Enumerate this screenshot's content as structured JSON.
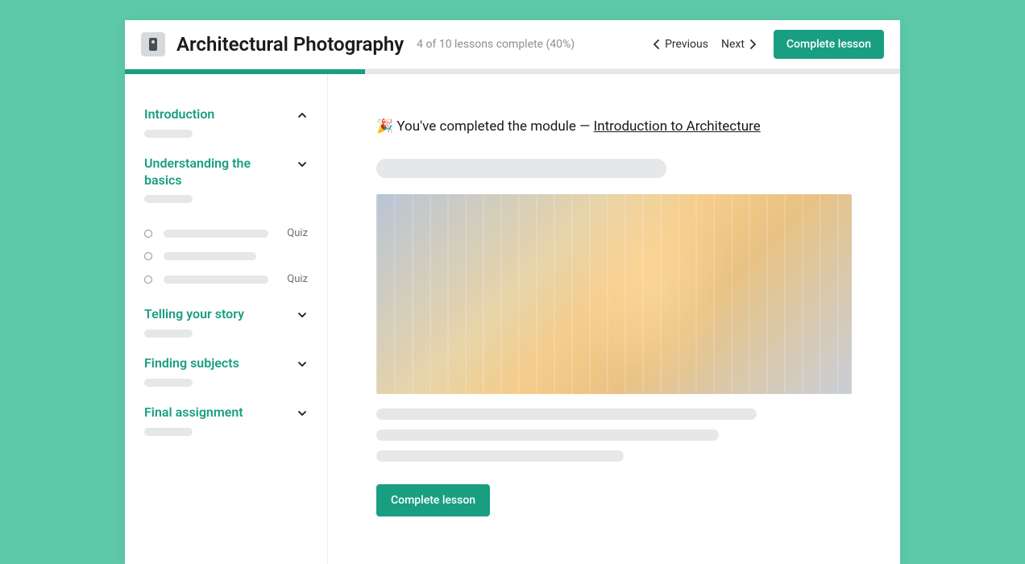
{
  "header": {
    "title": "Architectural Photography",
    "progress_text": "4 of 10 lessons complete (40%)",
    "previous": "Previous",
    "next": "Next",
    "complete_button": "Complete lesson"
  },
  "progress": {
    "percent": 31
  },
  "sidebar": {
    "modules": [
      {
        "title": "Introduction",
        "expanded": true
      },
      {
        "title": "Understanding the basics",
        "expanded": false,
        "lessons": [
          {
            "tag": "Quiz"
          },
          {
            "tag": ""
          },
          {
            "tag": "Quiz"
          }
        ]
      },
      {
        "title": "Telling your story",
        "expanded": false
      },
      {
        "title": "Finding subjects",
        "expanded": false
      },
      {
        "title": "Final assignment",
        "expanded": false
      }
    ]
  },
  "main": {
    "emoji": "🎉",
    "completion_prefix": "You've completed the module — ",
    "completion_module": "Introduction to Architecture",
    "complete_button": "Complete lesson"
  }
}
